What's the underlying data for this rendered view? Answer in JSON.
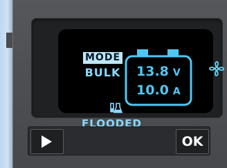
{
  "display": {
    "mode_label": "MODE",
    "mode_value": "BULK",
    "battery_type": "FLOODED",
    "voltage_value": "13.8",
    "voltage_unit": "V",
    "current_value": "10.0",
    "current_unit": "A"
  },
  "controls": {
    "ok_label": "OK",
    "play_icon": "play-icon"
  },
  "colors": {
    "lcd_background": "#000000",
    "lcd_text": "#8ad8ff",
    "reading_text": "#4fc7f4",
    "mode_badge": "#bfe7f6",
    "panel": "#4a4c4f"
  },
  "icons": {
    "fan": "fan-icon",
    "battery": "battery-icon",
    "flask": "flask-icon"
  }
}
